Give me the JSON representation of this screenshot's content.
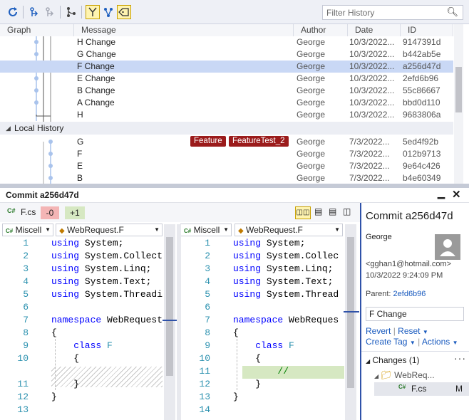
{
  "toolbar": {
    "filter_placeholder": "Filter History",
    "icons": [
      "refresh-icon",
      "go-back-icon",
      "go-forward-icon",
      "branch-graph-icon",
      "first-parent-icon",
      "show-merge-icon",
      "show-tags-icon",
      "search-icon"
    ]
  },
  "history": {
    "columns": [
      "Graph",
      "Message",
      "Author",
      "Date",
      "ID"
    ],
    "rows": [
      {
        "message": "H Change",
        "author": "George",
        "date": "10/3/2022...",
        "id": "9147391d"
      },
      {
        "message": "G Change",
        "author": "George",
        "date": "10/3/2022...",
        "id": "b442ab5e"
      },
      {
        "message": "F Change",
        "author": "George",
        "date": "10/3/2022...",
        "id": "a256d47d",
        "selected": true
      },
      {
        "message": "E Change",
        "author": "George",
        "date": "10/3/2022...",
        "id": "2efd6b96"
      },
      {
        "message": "B Change",
        "author": "George",
        "date": "10/3/2022...",
        "id": "55c86667"
      },
      {
        "message": "A Change",
        "author": "George",
        "date": "10/3/2022...",
        "id": "bbd0d110"
      },
      {
        "message": "H",
        "author": "George",
        "date": "10/3/2022...",
        "id": "9683806a"
      }
    ],
    "local_group": "Local History",
    "local_rows": [
      {
        "message": "G",
        "author": "George",
        "date": "7/3/2022...",
        "id": "5ed4f92b",
        "tags": [
          "Feature",
          "FeatureTest_2"
        ]
      },
      {
        "message": "F",
        "author": "George",
        "date": "7/3/2022...",
        "id": "012b9713"
      },
      {
        "message": "E",
        "author": "George",
        "date": "7/3/2022...",
        "id": "9e64c426"
      },
      {
        "message": "B",
        "author": "George",
        "date": "7/3/2022...",
        "id": "b4e60349"
      }
    ]
  },
  "commit_pane": {
    "title": "Commit a256d47d",
    "file": "F.cs",
    "file_icon": "C#",
    "removed": "-0",
    "added": "+1",
    "left": {
      "project": "Miscell",
      "class": "WebRequest.F"
    },
    "right": {
      "project": "Miscell",
      "class": "WebRequest.F"
    },
    "left_lines": [
      {
        "n": "1",
        "t": [
          [
            "kw",
            "using"
          ],
          [
            "",
            "System;"
          ]
        ]
      },
      {
        "n": "2",
        "t": [
          [
            "kw",
            "using"
          ],
          [
            "",
            "System.Collecti"
          ]
        ]
      },
      {
        "n": "3",
        "t": [
          [
            "kw",
            "using"
          ],
          [
            "",
            "System.Linq;"
          ]
        ]
      },
      {
        "n": "4",
        "t": [
          [
            "kw",
            "using"
          ],
          [
            "",
            "System.Text;"
          ]
        ]
      },
      {
        "n": "5",
        "t": [
          [
            "kw",
            "using"
          ],
          [
            "",
            "System.Threadin"
          ]
        ]
      },
      {
        "n": "6",
        "t": []
      },
      {
        "n": "7",
        "t": [
          [
            "kw",
            "namespace"
          ],
          [
            "",
            "WebRequest"
          ]
        ]
      },
      {
        "n": "8",
        "t": [
          [
            "",
            "{"
          ]
        ]
      },
      {
        "n": "9",
        "t": [
          [
            "kw",
            "    class"
          ],
          [
            "ty",
            "F"
          ]
        ]
      },
      {
        "n": "10",
        "t": [
          [
            "",
            "    {"
          ]
        ]
      },
      {
        "n": "",
        "t": [],
        "hatch": true
      },
      {
        "n": "11",
        "t": [
          [
            "",
            "    }"
          ]
        ]
      },
      {
        "n": "12",
        "t": [
          [
            "",
            "}"
          ]
        ]
      },
      {
        "n": "13",
        "t": []
      }
    ],
    "right_lines": [
      {
        "n": "1",
        "t": [
          [
            "kw",
            "using"
          ],
          [
            "",
            "System;"
          ]
        ]
      },
      {
        "n": "2",
        "t": [
          [
            "kw",
            "using"
          ],
          [
            "",
            "System.Collec"
          ]
        ]
      },
      {
        "n": "3",
        "t": [
          [
            "kw",
            "using"
          ],
          [
            "",
            "System.Linq;"
          ]
        ]
      },
      {
        "n": "4",
        "t": [
          [
            "kw",
            "using"
          ],
          [
            "",
            "System.Text;"
          ]
        ]
      },
      {
        "n": "5",
        "t": [
          [
            "kw",
            "using"
          ],
          [
            "",
            "System.Thread"
          ]
        ]
      },
      {
        "n": "6",
        "t": []
      },
      {
        "n": "7",
        "t": [
          [
            "kw",
            "namespace"
          ],
          [
            "",
            "WebReques"
          ]
        ]
      },
      {
        "n": "8",
        "t": [
          [
            "",
            "{"
          ]
        ]
      },
      {
        "n": "9",
        "t": [
          [
            "kw",
            "    class"
          ],
          [
            "ty",
            "F"
          ]
        ]
      },
      {
        "n": "10",
        "t": [
          [
            "",
            "    {"
          ]
        ]
      },
      {
        "n": "11",
        "t": [
          [
            "cm",
            "        //"
          ]
        ],
        "added": true
      },
      {
        "n": "12",
        "t": [
          [
            "",
            "    }"
          ]
        ]
      },
      {
        "n": "13",
        "t": [
          [
            "",
            "}"
          ]
        ]
      },
      {
        "n": "14",
        "t": []
      }
    ]
  },
  "details": {
    "title": "Commit a256d47d",
    "author": "George",
    "email": "<gghan1@hotmail.com>",
    "date": "10/3/2022 9:24:09 PM",
    "parent_label": "Parent:",
    "parent": "2efd6b96",
    "message": "F Change",
    "revert": "Revert",
    "reset": "Reset",
    "create_tag": "Create Tag",
    "actions": "Actions",
    "changes": "Changes (1)",
    "folder": "WebReq...",
    "file": "F.cs",
    "file_status": "M"
  },
  "colors": {
    "accent": "#2f52a9",
    "tag": "#9b1b1b",
    "selected": "#c9d8f5",
    "added_bg": "#d6e8c2",
    "removed_bg": "#f4b5b5"
  }
}
